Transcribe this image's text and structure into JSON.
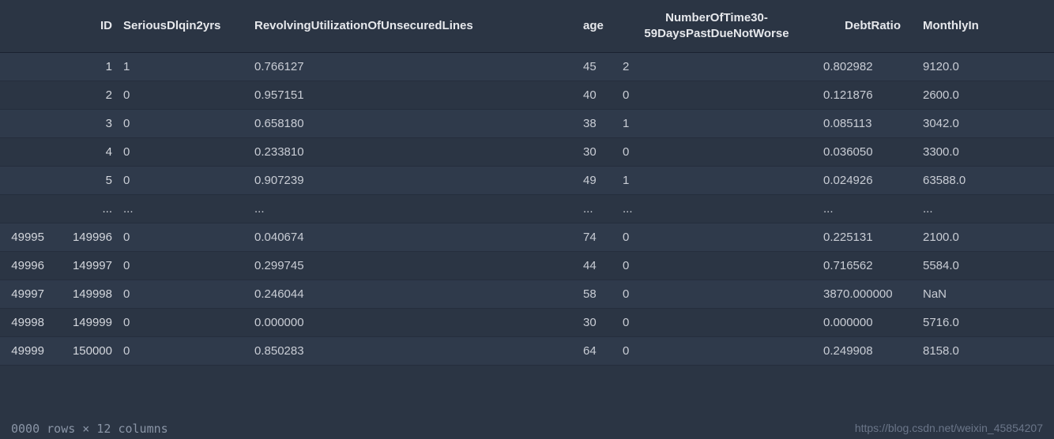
{
  "columns": {
    "idx": "",
    "id": "ID",
    "dlq": "SeriousDlqin2yrs",
    "revolv": "RevolvingUtilizationOfUnsecuredLines",
    "age": "age",
    "num30": "NumberOfTime30-59DaysPastDueNotWorse",
    "debt": "DebtRatio",
    "monthly": "MonthlyIn"
  },
  "rows": [
    {
      "idx": "",
      "id": "1",
      "dlq": "1",
      "revolv": "0.766127",
      "age": "45",
      "num30": "2",
      "debt": "0.802982",
      "monthly": "9120.0"
    },
    {
      "idx": "",
      "id": "2",
      "dlq": "0",
      "revolv": "0.957151",
      "age": "40",
      "num30": "0",
      "debt": "0.121876",
      "monthly": "2600.0"
    },
    {
      "idx": "",
      "id": "3",
      "dlq": "0",
      "revolv": "0.658180",
      "age": "38",
      "num30": "1",
      "debt": "0.085113",
      "monthly": "3042.0"
    },
    {
      "idx": "",
      "id": "4",
      "dlq": "0",
      "revolv": "0.233810",
      "age": "30",
      "num30": "0",
      "debt": "0.036050",
      "monthly": "3300.0"
    },
    {
      "idx": "",
      "id": "5",
      "dlq": "0",
      "revolv": "0.907239",
      "age": "49",
      "num30": "1",
      "debt": "0.024926",
      "monthly": "63588.0"
    },
    {
      "idx": "",
      "id": "...",
      "dlq": "...",
      "revolv": "...",
      "age": "...",
      "num30": "...",
      "debt": "...",
      "monthly": "..."
    },
    {
      "idx": "49995",
      "id": "149996",
      "dlq": "0",
      "revolv": "0.040674",
      "age": "74",
      "num30": "0",
      "debt": "0.225131",
      "monthly": "2100.0"
    },
    {
      "idx": "49996",
      "id": "149997",
      "dlq": "0",
      "revolv": "0.299745",
      "age": "44",
      "num30": "0",
      "debt": "0.716562",
      "monthly": "5584.0"
    },
    {
      "idx": "49997",
      "id": "149998",
      "dlq": "0",
      "revolv": "0.246044",
      "age": "58",
      "num30": "0",
      "debt": "3870.000000",
      "monthly": "NaN"
    },
    {
      "idx": "49998",
      "id": "149999",
      "dlq": "0",
      "revolv": "0.000000",
      "age": "30",
      "num30": "0",
      "debt": "0.000000",
      "monthly": "5716.0"
    },
    {
      "idx": "49999",
      "id": "150000",
      "dlq": "0",
      "revolv": "0.850283",
      "age": "64",
      "num30": "0",
      "debt": "0.249908",
      "monthly": "8158.0"
    }
  ],
  "footer": {
    "summary": "0000 rows × 12 columns",
    "watermark": "https://blog.csdn.net/weixin_45854207"
  }
}
